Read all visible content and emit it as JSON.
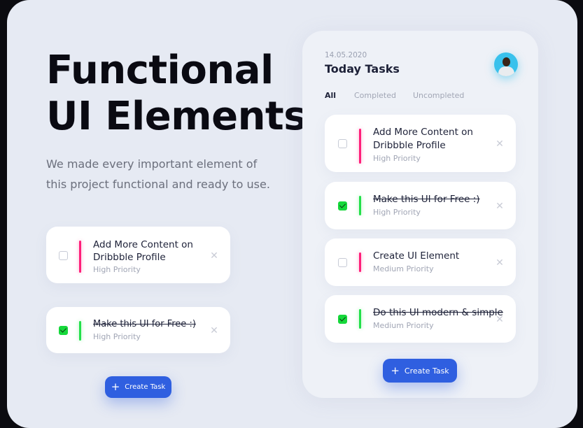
{
  "hero": {
    "title_line1": "Functional",
    "title_line2": "UI Elements",
    "subtitle": "We made every important element of this project functional and ready to use."
  },
  "demo_tasks": [
    {
      "title": "Add More Content on Dribbble Profile",
      "priority": "High Priority",
      "done": false,
      "color": "#ff1f7a"
    },
    {
      "title": "Make this UI for Free :)",
      "priority": "High Priority",
      "done": true,
      "color": "#23e04a"
    }
  ],
  "create_button": {
    "label": "Create Task",
    "icon": "plus-icon",
    "color": "#2f5fe0"
  },
  "panel": {
    "date": "14.05.2020",
    "title": "Today Tasks",
    "tabs": [
      "All",
      "Completed",
      "Uncompleted"
    ],
    "active_tab": "All",
    "tasks": [
      {
        "title_line1": "Add More Content on",
        "title_line2": "Dribbble Profile",
        "priority": "High Priority",
        "done": false,
        "color": "#ff1f7a"
      },
      {
        "title_line1": "Make this UI for Free :)",
        "priority": "High Priority",
        "done": true,
        "color": "#23e04a"
      },
      {
        "title_line1": "Create UI Element",
        "priority": "Medium Priority",
        "done": false,
        "color": "#ff1f7a"
      },
      {
        "title_line1": "Do this UI modern & simple",
        "priority": "Medium Priority",
        "done": true,
        "color": "#23e04a"
      }
    ],
    "create_button_label": "Create Task"
  },
  "colors": {
    "background": "#e6eaf3",
    "accent": "#2f5fe0",
    "high": "#ff1f7a",
    "done": "#23e04a",
    "avatar_bg": "#39c1ec"
  }
}
